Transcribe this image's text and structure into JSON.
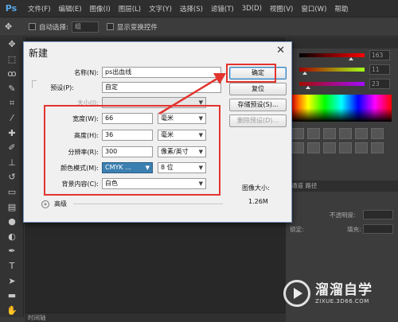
{
  "app": {
    "logo": "Ps"
  },
  "menu": [
    "文件(F)",
    "编辑(E)",
    "图像(I)",
    "图层(L)",
    "文字(Y)",
    "选择(S)",
    "滤镜(T)",
    "3D(D)",
    "视图(V)",
    "窗口(W)",
    "帮助"
  ],
  "options_bar": {
    "auto_select": "自动选择:",
    "auto_select_value": "组",
    "show_transform": "显示变换控件"
  },
  "dialog": {
    "title": "新建",
    "name_label": "名称(N):",
    "name_value": "ps出血线",
    "preset_label": "预设(P):",
    "preset_value": "自定",
    "size_label": "大小(I):",
    "width_label": "宽度(W):",
    "width_value": "66",
    "width_unit": "毫米",
    "height_label": "高度(H):",
    "height_value": "36",
    "height_unit": "毫米",
    "resolution_label": "分辨率(R):",
    "resolution_value": "300",
    "resolution_unit": "像素/英寸",
    "color_mode_label": "颜色模式(M):",
    "color_mode_value": "CMYK ...",
    "bit_depth": "8 位",
    "background_label": "背景内容(C):",
    "background_value": "白色",
    "advanced_label": "高级",
    "buttons": {
      "ok": "确定",
      "reset": "复位",
      "save_preset": "存储预设(S)...",
      "delete_preset": "删除预设(D)..."
    },
    "image_size_label": "图像大小:",
    "image_size_value": "1.26M"
  },
  "right_panel": {
    "color_values": [
      "163",
      "11",
      "23"
    ],
    "layers_tab": "通道  路径",
    "opacity_label": "不透明度:",
    "lock_label": "锁定:",
    "fill_label": "填充:"
  },
  "timeline_label": "时间轴",
  "watermark": {
    "name": "溜溜自学",
    "url": "ZIXUE.3D66.COM"
  },
  "colors": {
    "annotation_red": "#e3342f",
    "ps_dark": "#3a3a3a",
    "dialog_bg": "#f0f0f0",
    "selection_blue": "#3c7fb1"
  }
}
